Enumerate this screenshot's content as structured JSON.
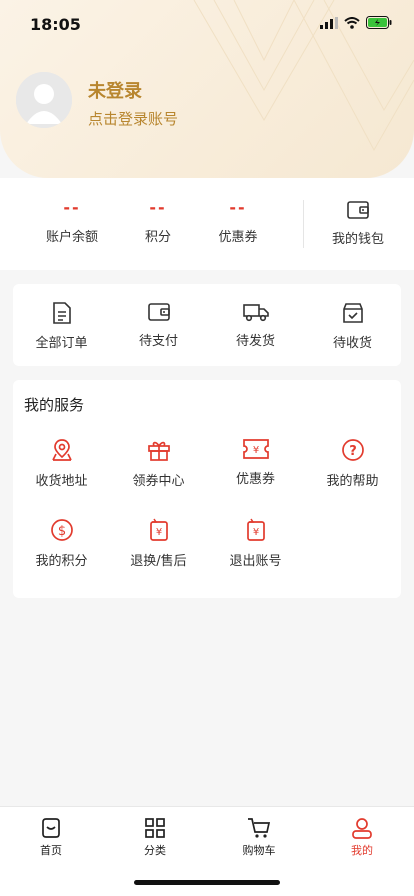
{
  "status": {
    "time": "18:05"
  },
  "user": {
    "title": "未登录",
    "subtitle": "点击登录账号"
  },
  "assets": [
    {
      "value": "--",
      "label": "账户余额"
    },
    {
      "value": "--",
      "label": "积分"
    },
    {
      "value": "--",
      "label": "优惠券"
    }
  ],
  "wallet": {
    "label": "我的钱包",
    "icon": "wallet-icon"
  },
  "orders": [
    {
      "label": "全部订单",
      "icon": "document-icon"
    },
    {
      "label": "待支付",
      "icon": "wallet-icon"
    },
    {
      "label": "待发货",
      "icon": "truck-icon"
    },
    {
      "label": "待收货",
      "icon": "box-check-icon"
    }
  ],
  "services": {
    "title": "我的服务",
    "items": [
      {
        "label": "收货地址",
        "icon": "map-pin-icon"
      },
      {
        "label": "领券中心",
        "icon": "gift-icon"
      },
      {
        "label": "优惠券",
        "icon": "coupon-icon"
      },
      {
        "label": "我的帮助",
        "icon": "help-icon"
      },
      {
        "label": "我的积分",
        "icon": "dollar-icon"
      },
      {
        "label": "退换/售后",
        "icon": "refund-icon"
      },
      {
        "label": "退出账号",
        "icon": "logout-icon"
      }
    ]
  },
  "tabs": [
    {
      "label": "首页",
      "icon": "home-icon",
      "active": false
    },
    {
      "label": "分类",
      "icon": "grid-icon",
      "active": false
    },
    {
      "label": "购物车",
      "icon": "cart-icon",
      "active": false
    },
    {
      "label": "我的",
      "icon": "user-icon",
      "active": true
    }
  ],
  "colors": {
    "accent": "#e23b2e",
    "gold": "#b8862f"
  }
}
